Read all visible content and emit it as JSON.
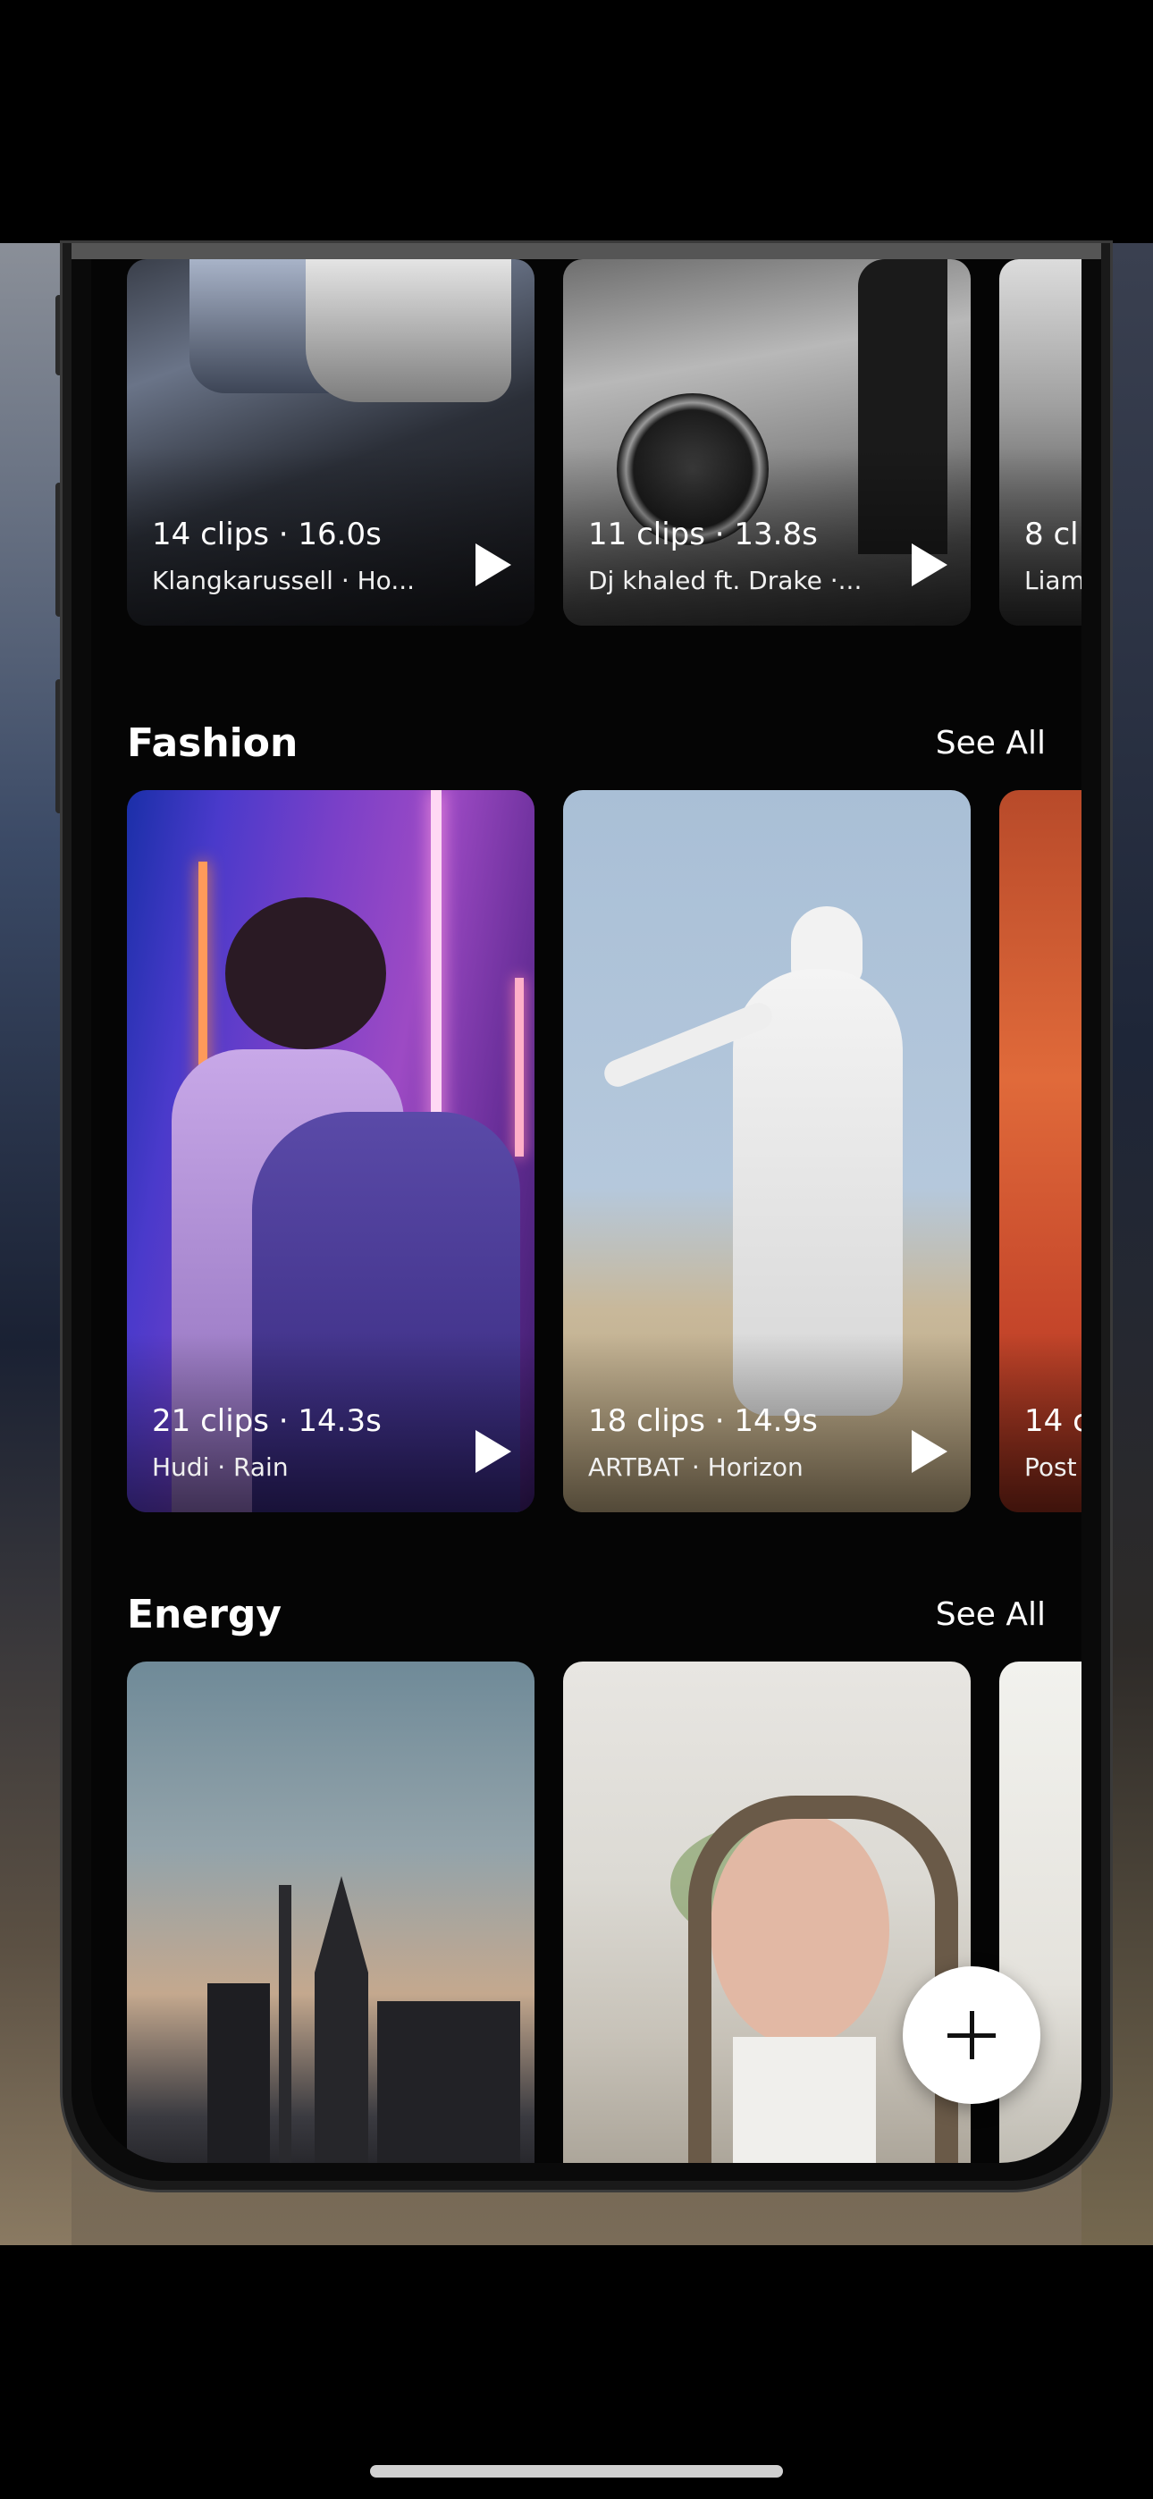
{
  "sections": {
    "top_row": {
      "cards": [
        {
          "clips": "14 clips · 16.0s",
          "subtitle": "Klangkarussell · Ho..."
        },
        {
          "clips": "11 clips · 13.8s",
          "subtitle": "Dj khaled ft. Drake ·..."
        },
        {
          "clips": "8 cl",
          "subtitle": "Liam"
        }
      ]
    },
    "fashion": {
      "title": "Fashion",
      "see_all": "See All",
      "cards": [
        {
          "clips": "21 clips · 14.3s",
          "subtitle": "Hudi · Rain"
        },
        {
          "clips": "18 clips · 14.9s",
          "subtitle": "ARTBAT · Horizon"
        },
        {
          "clips": "14 c",
          "subtitle": "Post"
        }
      ]
    },
    "energy": {
      "title": "Energy",
      "see_all": "See All"
    }
  },
  "fab": {
    "icon": "plus-icon"
  }
}
